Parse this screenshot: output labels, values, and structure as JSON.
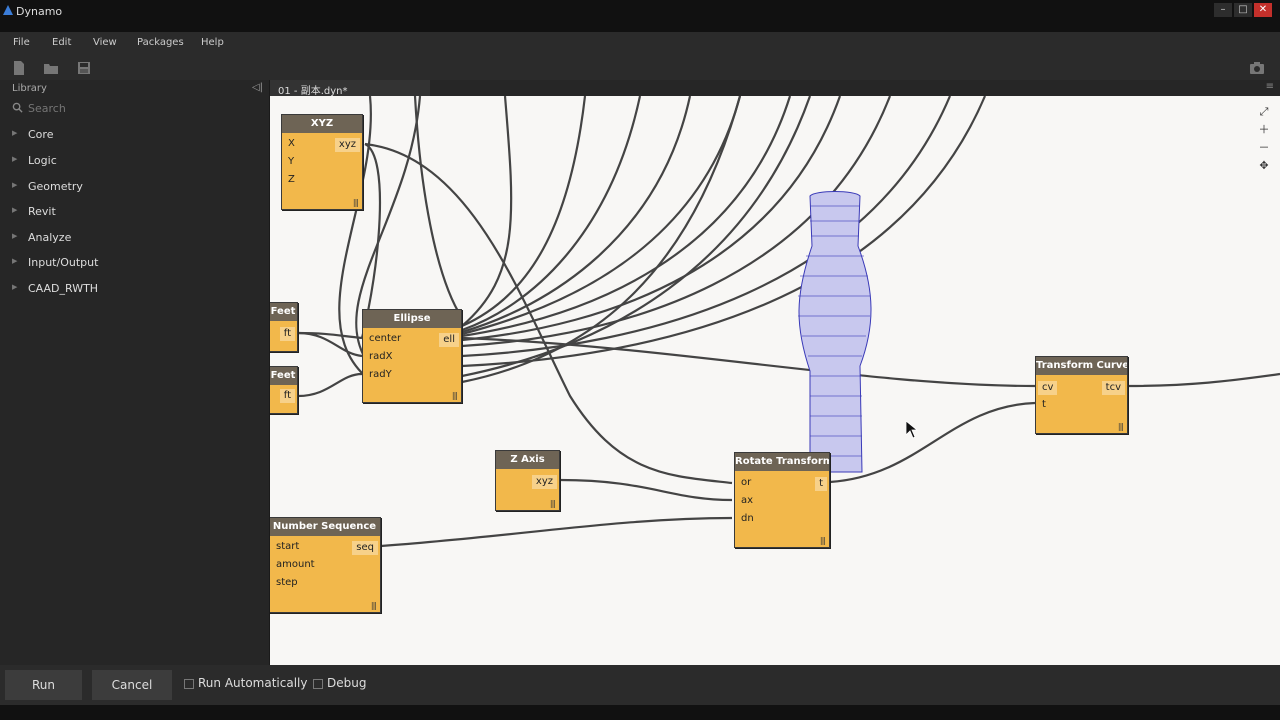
{
  "window": {
    "title": "Dynamo"
  },
  "menu": {
    "file": "File",
    "edit": "Edit",
    "view": "View",
    "packages": "Packages",
    "help": "Help"
  },
  "library": {
    "header": "Library",
    "search_placeholder": "Search",
    "items": [
      {
        "label": "Core"
      },
      {
        "label": "Logic"
      },
      {
        "label": "Geometry"
      },
      {
        "label": "Revit"
      },
      {
        "label": "Analyze"
      },
      {
        "label": "Input/Output"
      },
      {
        "label": "CAAD_RWTH"
      }
    ]
  },
  "tab": {
    "label": "01 - 副本.dyn*"
  },
  "nodes": {
    "xyz": {
      "title": "XYZ",
      "inputs": [
        "X",
        "Y",
        "Z"
      ],
      "output": "xyz",
      "lacing": "|||"
    },
    "feet1": {
      "title": "Feet",
      "output": "ft"
    },
    "feet2": {
      "title": "Feet",
      "output": "ft"
    },
    "ellipse": {
      "title": "Ellipse",
      "inputs": [
        "center",
        "radX",
        "radY"
      ],
      "output": "ell",
      "lacing": "|||"
    },
    "zaxis": {
      "title": "Z Axis",
      "output": "xyz",
      "lacing": "|||"
    },
    "number_sequence": {
      "title": "Number Sequence",
      "inputs": [
        "start",
        "amount",
        "step"
      ],
      "output": "seq",
      "lacing": "|||"
    },
    "rotate_transform": {
      "title": "Rotate Transform",
      "inputs": [
        "or",
        "ax",
        "dn"
      ],
      "output": "t",
      "lacing": "|||"
    },
    "transform_curve": {
      "title": "Transform Curve",
      "inputs": [
        "cv",
        "t"
      ],
      "output": "tcv",
      "lacing": "|||"
    }
  },
  "bottom": {
    "run": "Run",
    "cancel": "Cancel",
    "run_automatically": "Run Automatically",
    "debug": "Debug"
  },
  "colors": {
    "node_body": "#f2b84b",
    "node_header": "#6e6455",
    "canvas": "#f8f7f5",
    "wire": "#444444",
    "preview_geometry": "#3a3ab8"
  }
}
